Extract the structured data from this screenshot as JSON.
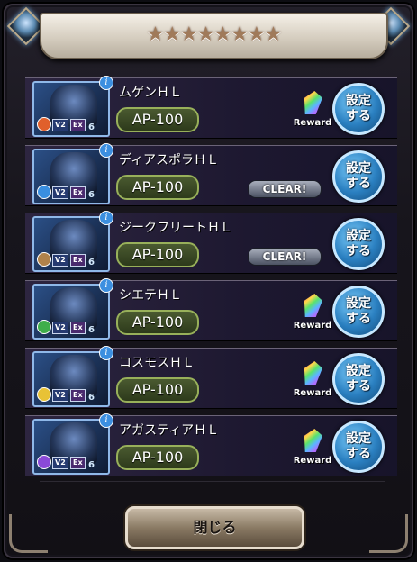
{
  "header": {
    "stars": "★★★★★★★★"
  },
  "quests": [
    {
      "name": "ムゲンＨＬ",
      "ap": "AP-100",
      "status": "reward",
      "element_color": "#e0602c",
      "element_icon": "fire-icon"
    },
    {
      "name": "ディアスポラＨＬ",
      "ap": "AP-100",
      "status": "clear",
      "element_color": "#3a8fe0",
      "element_icon": "water-icon"
    },
    {
      "name": "ジークフリートＨＬ",
      "ap": "AP-100",
      "status": "clear",
      "element_color": "#b0824a",
      "element_icon": "earth-icon"
    },
    {
      "name": "シエテＨＬ",
      "ap": "AP-100",
      "status": "reward",
      "element_color": "#3fae4a",
      "element_icon": "wind-icon"
    },
    {
      "name": "コスモスＨＬ",
      "ap": "AP-100",
      "status": "reward",
      "element_color": "#e8c236",
      "element_icon": "light-icon"
    },
    {
      "name": "アガスティアＨＬ",
      "ap": "AP-100",
      "status": "reward",
      "element_color": "#8a4ad8",
      "element_icon": "dark-icon"
    }
  ],
  "labels": {
    "v2": "V2",
    "ex": "Ex",
    "party_count": "6",
    "info": "i",
    "clear": "CLEAR!",
    "reward": "Reward",
    "set_line1": "設定",
    "set_line2": "する",
    "close": "閉じる"
  }
}
